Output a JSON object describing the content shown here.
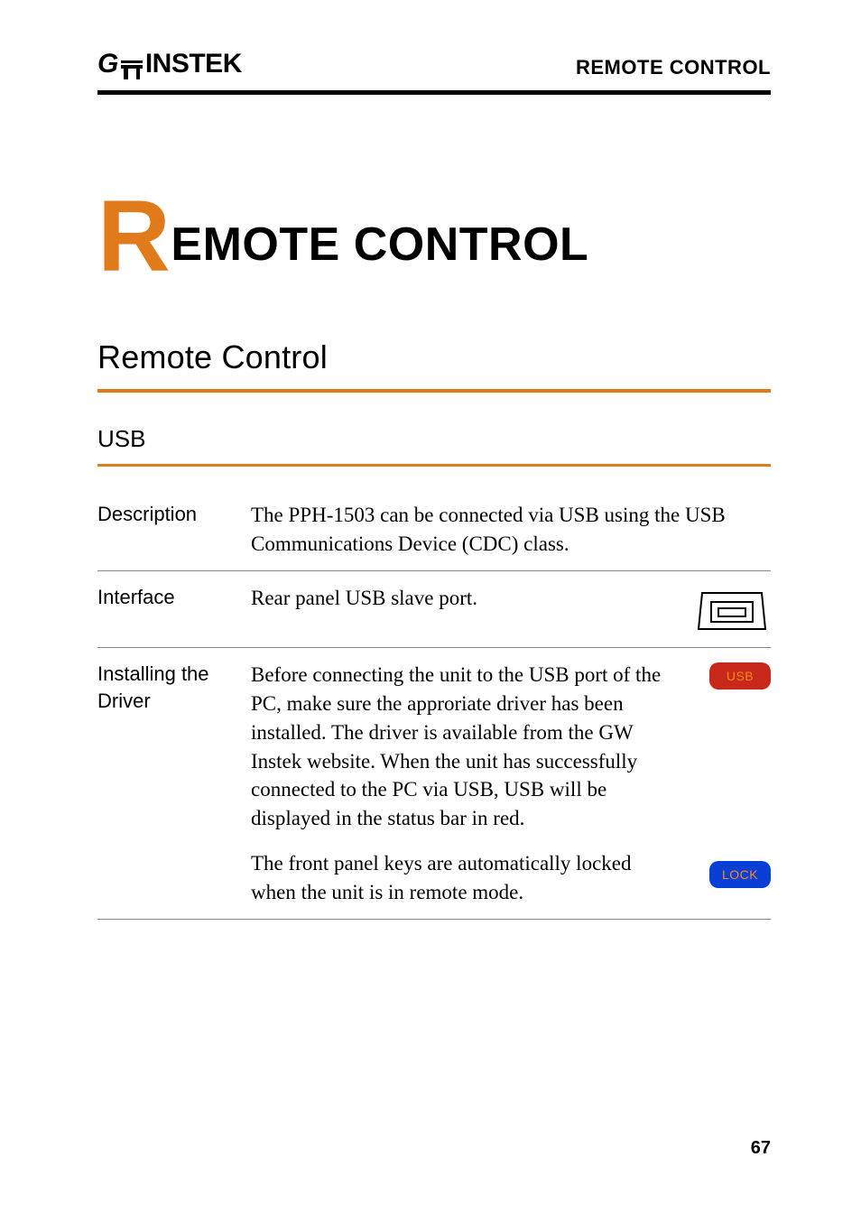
{
  "header": {
    "brand_prefix": "G",
    "brand_suffix": "INSTEK",
    "section_label": "REMOTE CONTROL"
  },
  "chapter": {
    "first_letter": "R",
    "rest": "EMOTE CONTROL"
  },
  "section_heading": "Remote Control",
  "subsection_heading": "USB",
  "rows": {
    "description": {
      "label": "Description",
      "text": "The PPH-1503 can be connected via USB using the USB Communications Device (CDC) class."
    },
    "interface": {
      "label": "Interface",
      "text": "Rear panel USB slave port."
    },
    "driver": {
      "label": "Installing the Driver",
      "p1": "Before connecting the unit to the USB port of the PC, make sure the approriate driver has been installed. The driver is available from the GW Instek website. When the unit has successfully connected to the PC via USB, USB will be displayed in the status bar in red.",
      "p2": "The front panel keys are automatically locked when the unit is in remote mode.",
      "badge_usb": "USB",
      "badge_lock": "LOCK"
    }
  },
  "page_number": "67"
}
